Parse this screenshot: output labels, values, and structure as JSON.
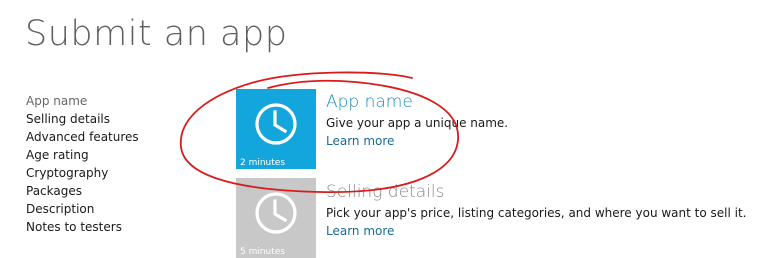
{
  "page": {
    "title": "Submit an app"
  },
  "sidebar": {
    "items": [
      {
        "label": "App name",
        "active": true
      },
      {
        "label": "Selling details",
        "active": false
      },
      {
        "label": "Advanced features",
        "active": false
      },
      {
        "label": "Age rating",
        "active": false
      },
      {
        "label": "Cryptography",
        "active": false
      },
      {
        "label": "Packages",
        "active": false
      },
      {
        "label": "Description",
        "active": false
      },
      {
        "label": "Notes to testers",
        "active": false
      }
    ]
  },
  "steps": [
    {
      "title": "App name",
      "description": "Give your app a unique name.",
      "link": "Learn more",
      "duration": "2 minutes",
      "icon": "clock-icon",
      "state": "current"
    },
    {
      "title": "Selling details",
      "description": "Pick your app's price, listing categories, and where you want to sell it.",
      "link": "Learn more",
      "duration": "5 minutes",
      "icon": "clock-icon",
      "state": "upcoming"
    }
  ],
  "colors": {
    "accent": "#12a6dc",
    "tile_disabled": "#c8c8c8",
    "title_current": "#1b8dbf",
    "title_upcoming": "#8a8a8a",
    "link": "#1a6a96",
    "annotation": "#d81b1b"
  }
}
